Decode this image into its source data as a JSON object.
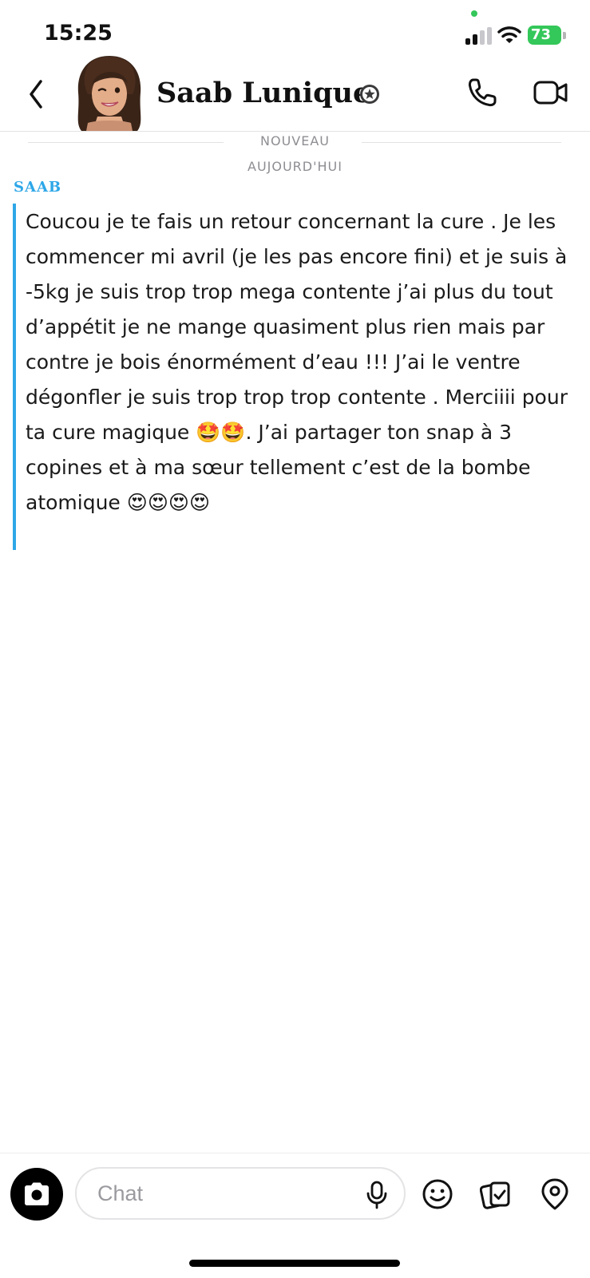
{
  "status_bar": {
    "time": "15:25",
    "battery": "73"
  },
  "header": {
    "contact_name": "Saab Lunique"
  },
  "conversation": {
    "new_label": "NOUVEAU",
    "date_label": "AUJOURD'HUI",
    "messages": [
      {
        "sender": "SAAB",
        "text": "Coucou je te fais un retour concernant la cure . Je les commencer mi avril (je les pas encore fini) et je suis à -5kg je suis trop trop mega contente j’ai plus du tout d’appétit je ne mange quasiment plus rien mais par contre je bois énormément d’eau !!! J’ai le ventre dégonfler je suis trop trop trop contente . Merciiii pour ta cure magique 🤩🤩. J’ai partager ton snap à 3 copines et à ma sœur tellement c’est de la bombe atomique 😍😍😍😍"
      }
    ]
  },
  "composer": {
    "placeholder": "Chat"
  },
  "colors": {
    "accent": "#2ea7e8",
    "battery_green": "#34c759",
    "muted_text": "#8e8e93"
  },
  "icons": [
    "back-icon",
    "call-icon",
    "video-icon",
    "camera-icon",
    "mic-icon",
    "smiley-icon",
    "memories-icon",
    "location-icon"
  ]
}
